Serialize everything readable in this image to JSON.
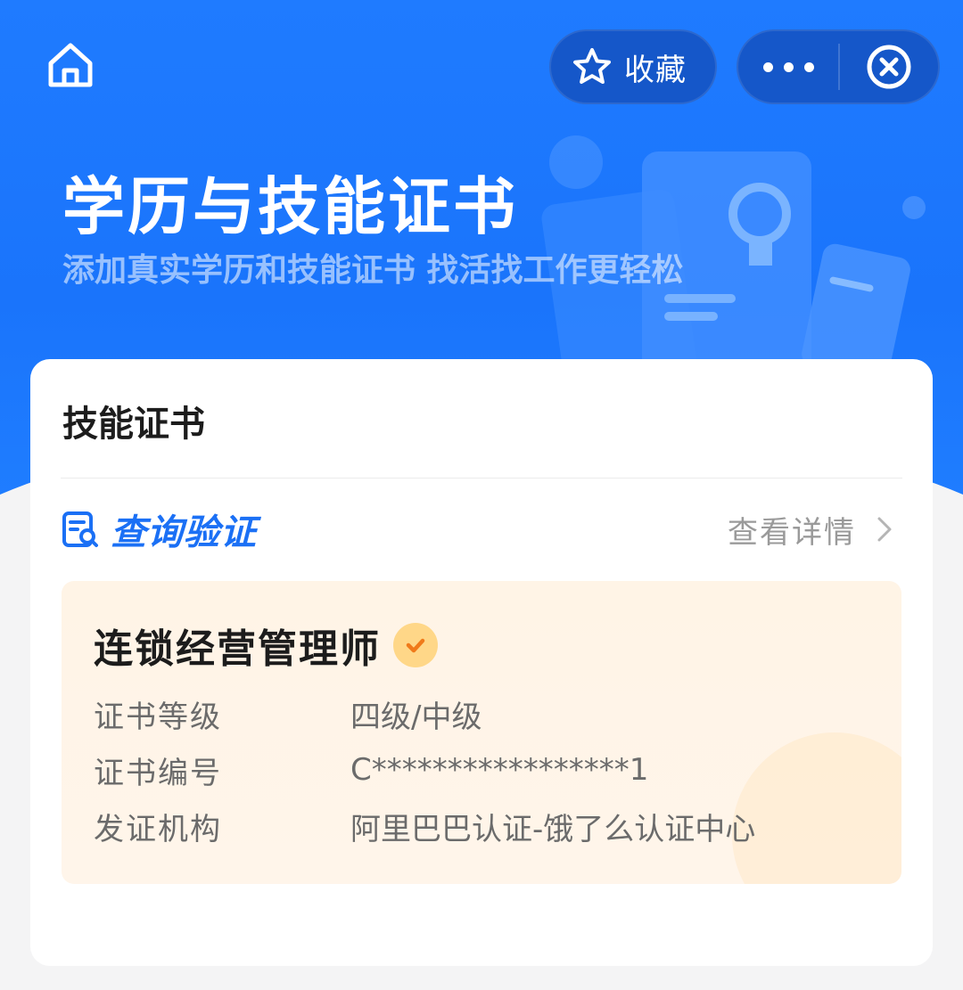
{
  "nav": {
    "favorite_label": "收藏"
  },
  "hero": {
    "title": "学历与技能证书",
    "subtitle": "添加真实学历和技能证书 找活找工作更轻松"
  },
  "card": {
    "title": "技能证书",
    "verify_label": "查询验证",
    "details_label": "查看详情",
    "certificate": {
      "name": "连锁经营管理师",
      "fields": [
        {
          "key": "证书等级",
          "value": "四级/中级"
        },
        {
          "key": "证书编号",
          "value": "C*****************1"
        },
        {
          "key": "发证机构",
          "value": "阿里巴巴认证-饿了么认证中心"
        }
      ]
    }
  },
  "colors": {
    "brand_blue": "#1f7bff",
    "verify_blue": "#1b70f5",
    "badge_orange": "#ffd788",
    "check_orange": "#f07a1a",
    "cert_bg": "#fff4e6"
  },
  "icons": [
    "home-icon",
    "star-icon",
    "more-icon",
    "close-circle-icon",
    "verify-search-icon",
    "chevron-right-icon",
    "verified-check-icon"
  ]
}
